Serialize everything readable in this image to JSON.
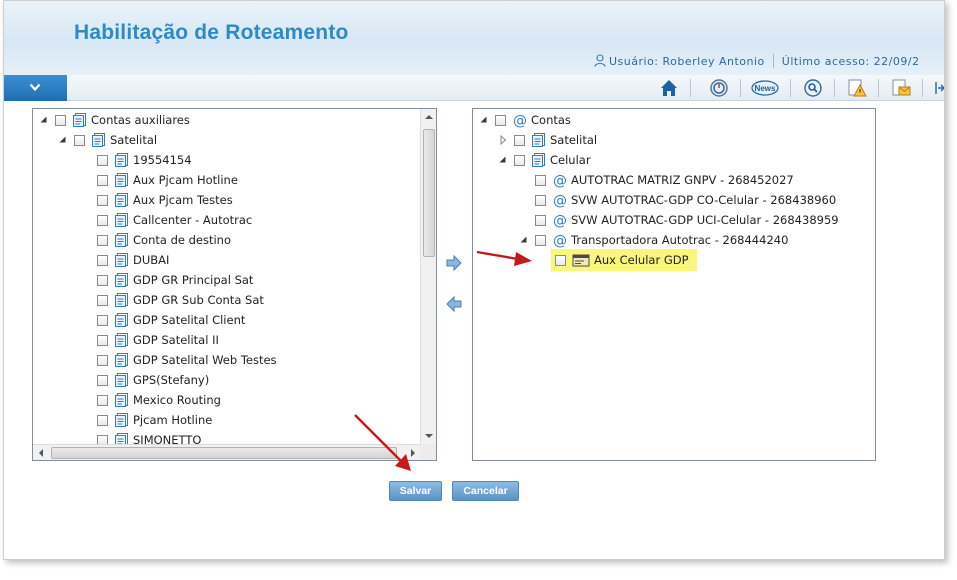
{
  "app": {
    "title": "Habilitação de Roteamento"
  },
  "user": {
    "label": "Usuário: Roberley Antonio",
    "last_access": "Último acesso: 22/09/2"
  },
  "toolbar": {
    "icons": [
      "home-icon",
      "timer-icon",
      "news-icon",
      "search-icon",
      "warning-icon",
      "mail-icon",
      "exit-icon"
    ],
    "news_label": "News"
  },
  "left_tree": {
    "root": "Contas auxiliares",
    "group": "Satelital",
    "items": [
      "19554154",
      "Aux Pjcam Hotline",
      "Aux Pjcam Testes",
      "Callcenter - Autotrac",
      "Conta de destino",
      "DUBAI",
      "GDP GR Principal Sat",
      "GDP GR Sub Conta Sat",
      "GDP Satelital Client",
      "GDP Satelital II",
      "GDP Satelital Web Testes",
      "GPS(Stefany)",
      "Mexico Routing",
      "Pjcam Hotline",
      "SIMONETTO"
    ]
  },
  "right_tree": {
    "root": "Contas",
    "satelital": "Satelital",
    "celular": "Celular",
    "accounts": [
      "AUTOTRAC MATRIZ GNPV - 268452027",
      "SVW AUTOTRAC-GDP CO-Celular - 268438960",
      "SVW AUTOTRAC-GDP UCI-Celular - 268438959",
      "Transportadora Autotrac - 268444240"
    ],
    "selected_child": "Aux Celular GDP"
  },
  "buttons": {
    "save": "Salvar",
    "cancel": "Cancelar"
  },
  "colors": {
    "title": "#2d8ac8",
    "highlight": "#faf57b",
    "button": "#5a93c6",
    "annotation": "#c41a1a"
  }
}
